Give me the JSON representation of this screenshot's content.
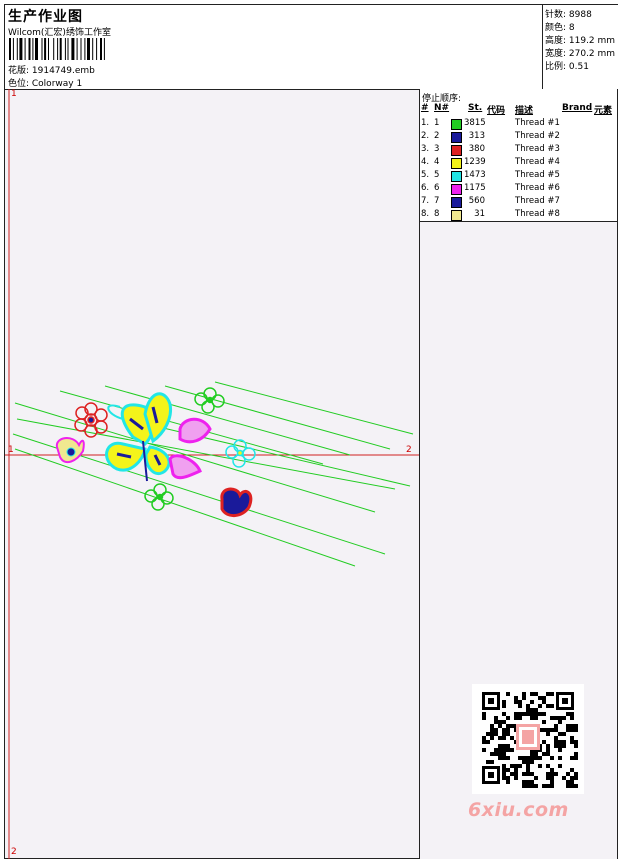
{
  "header": {
    "title": "生产作业图",
    "studio": "Wilcom(汇宏)绣饰工作室",
    "design_file": "花版: 1914749.emb",
    "colorway": "色位: Colorway 1"
  },
  "stats": {
    "stitches": "针数: 8988",
    "colors": "颜色: 8",
    "height": "高度: 119.2 mm",
    "width": "宽度: 270.2 mm",
    "scale": "比例: 0.51"
  },
  "stop_sequence": {
    "title": "停止顺序:",
    "headers": {
      "no": "#",
      "needle": "N#",
      "stitches": "St.",
      "code": "代码",
      "description": "描述",
      "brand": "Brand",
      "element": "元素"
    },
    "rows": [
      {
        "no": "1.",
        "needle": "1",
        "color": "#22cc22",
        "stitches": "3815",
        "description": "Thread #1"
      },
      {
        "no": "2.",
        "needle": "2",
        "color": "#1a1a9a",
        "stitches": "313",
        "description": "Thread #2"
      },
      {
        "no": "3.",
        "needle": "3",
        "color": "#dd2222",
        "stitches": "380",
        "description": "Thread #3"
      },
      {
        "no": "4.",
        "needle": "4",
        "color": "#f4f41a",
        "stitches": "1239",
        "description": "Thread #4"
      },
      {
        "no": "5.",
        "needle": "5",
        "color": "#22e6e6",
        "stitches": "1473",
        "description": "Thread #5"
      },
      {
        "no": "6.",
        "needle": "6",
        "color": "#ee22ee",
        "stitches": "1175",
        "description": "Thread #6"
      },
      {
        "no": "7.",
        "needle": "7",
        "color": "#1a1a9a",
        "stitches": "560",
        "description": "Thread #7"
      },
      {
        "no": "8.",
        "needle": "8",
        "color": "#f0e890",
        "stitches": "31",
        "description": "Thread #8"
      }
    ]
  },
  "canvas": {
    "axis_markers": {
      "top": "1",
      "right": "2",
      "left": "1",
      "bottom": "2"
    }
  },
  "watermark": {
    "text": "6xiu.com"
  }
}
